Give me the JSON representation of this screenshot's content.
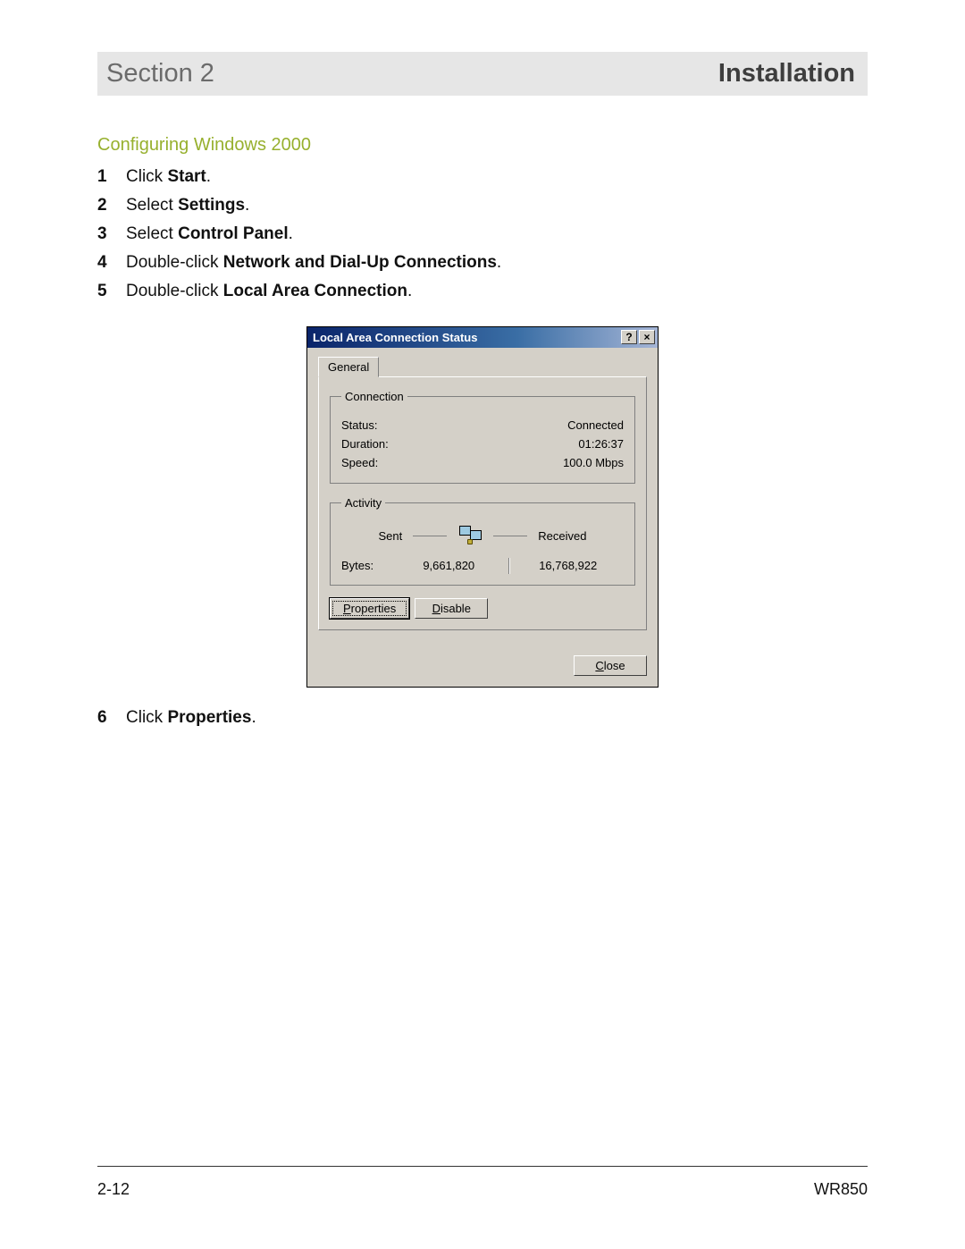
{
  "header": {
    "left": "Section 2",
    "right": "Installation"
  },
  "subheading": "Configuring Windows 2000",
  "steps": [
    {
      "num": "1",
      "pre": "Click ",
      "bold": "Start",
      "post": "."
    },
    {
      "num": "2",
      "pre": "Select ",
      "bold": "Settings",
      "post": "."
    },
    {
      "num": "3",
      "pre": "Select ",
      "bold": "Control Panel",
      "post": "."
    },
    {
      "num": "4",
      "pre": "Double-click ",
      "bold": "Network and Dial-Up Connections",
      "post": "."
    },
    {
      "num": "5",
      "pre": "Double-click ",
      "bold": "Local Area Connection",
      "post": "."
    }
  ],
  "step6": {
    "num": "6",
    "pre": "Click ",
    "bold": "Properties",
    "post": "."
  },
  "dialog": {
    "title": "Local Area Connection Status",
    "tab_general": "General",
    "connection": {
      "legend": "Connection",
      "status_label": "Status:",
      "status_value": "Connected",
      "duration_label": "Duration:",
      "duration_value": "01:26:37",
      "speed_label": "Speed:",
      "speed_value": "100.0 Mbps"
    },
    "activity": {
      "legend": "Activity",
      "sent": "Sent",
      "received": "Received",
      "bytes_label": "Bytes:",
      "bytes_sent": "9,661,820",
      "bytes_received": "16,768,922"
    },
    "buttons": {
      "properties_u": "P",
      "properties_rest": "roperties",
      "disable_u": "D",
      "disable_rest": "isable",
      "close_u": "C",
      "close_rest": "lose"
    },
    "titlebar_icons": {
      "help": "?",
      "close": "×"
    }
  },
  "footer": {
    "page": "2-12",
    "model": "WR850"
  }
}
